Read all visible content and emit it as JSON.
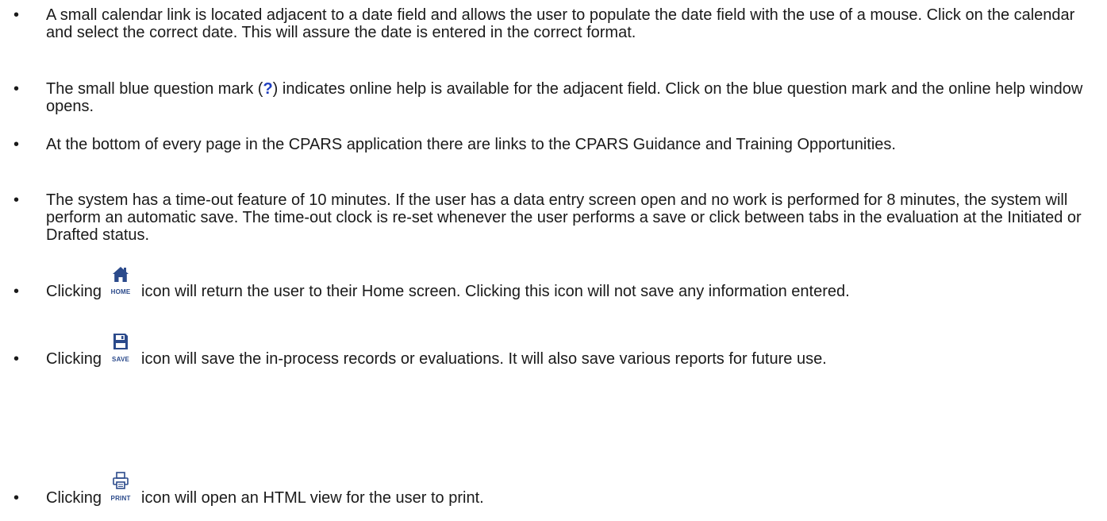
{
  "bullets": [
    {
      "text": "A small calendar link is located adjacent to a date field and allows the user to populate the date field with the use of a mouse. Click on the calendar and select the correct date. This will assure the date is entered in the correct format."
    },
    {
      "before": "The small blue question mark (",
      "qmark": "?",
      "after": ") indicates online help is available for the adjacent field. Click on the blue question mark and the online help window opens."
    },
    {
      "text": "At the bottom of every page in the CPARS application there are links to the CPARS Guidance and Training Opportunities."
    },
    {
      "text": "The system has a time-out feature of 10 minutes. If the user has a data entry screen open and no work is performed for 8 minutes, the system will perform an automatic save. The time-out clock is re-set whenever the user performs a save or click between tabs in the evaluation at the Initiated or Drafted status."
    },
    {
      "before": "Clicking",
      "icon_label": "HOME",
      "icon": "home-icon",
      "after": "icon will return the user to their Home screen. Clicking this icon will not save any information entered."
    },
    {
      "before": "Clicking",
      "icon_label": "SAVE",
      "icon": "save-icon",
      "after": "icon will save the in-process records or evaluations. It will also save various reports for future use."
    },
    {
      "before": "Clicking",
      "icon_label": "PRINT",
      "icon": "print-icon",
      "after": "icon will open an HTML view for the user to print."
    }
  ],
  "bullet_symbol": "•",
  "colors": {
    "text": "#1a1a1a",
    "question_mark": "#1f3fbf",
    "icon": "#2b4a8b"
  }
}
